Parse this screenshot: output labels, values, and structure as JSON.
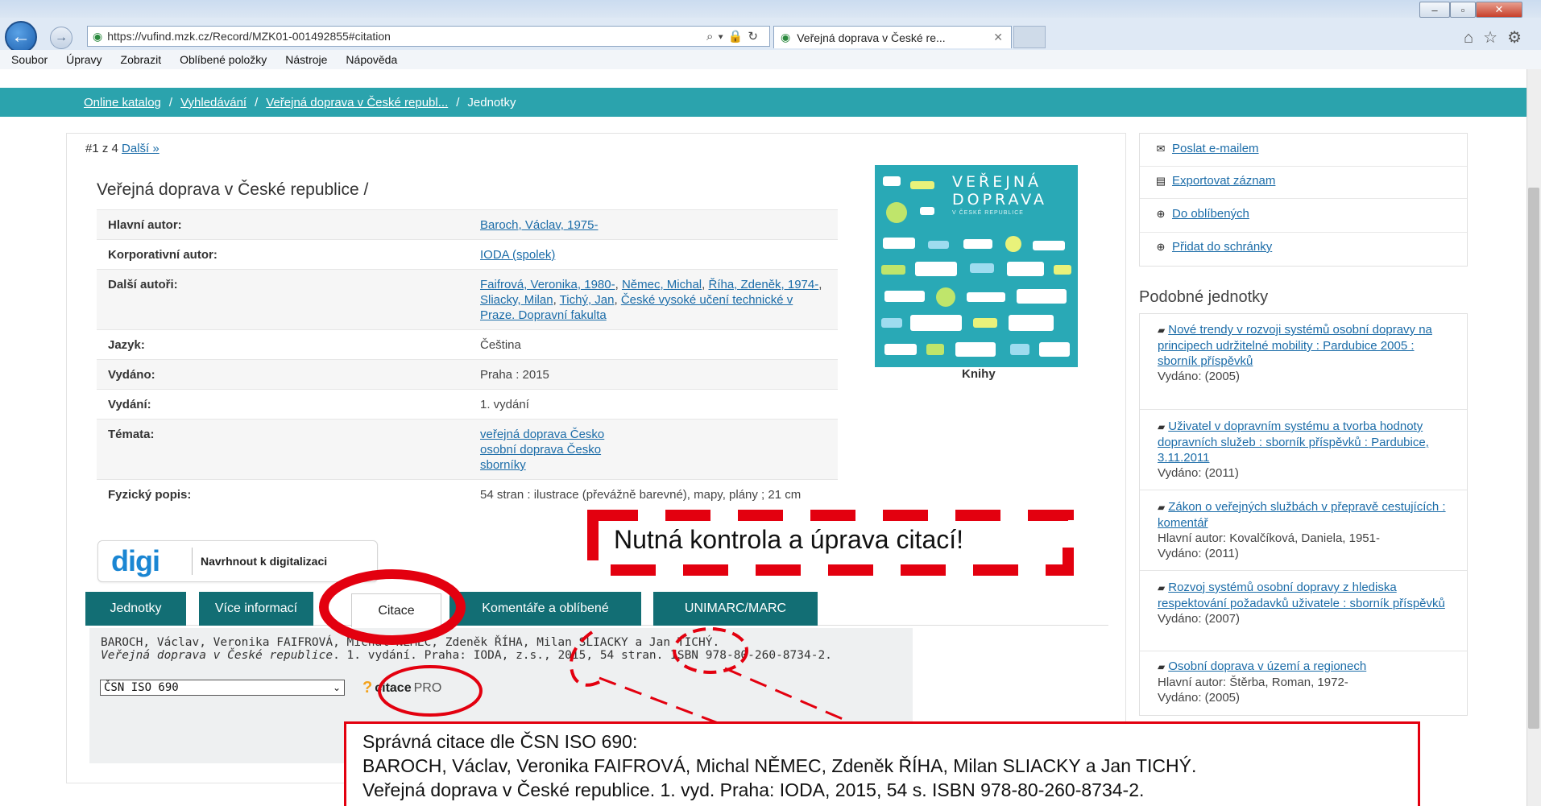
{
  "browser": {
    "url": "https://vufind.mzk.cz/Record/MZK01-001492855#citation",
    "tab_title": "Veřejná doprava v České re...",
    "menu": [
      "Soubor",
      "Úpravy",
      "Zobrazit",
      "Oblíbené položky",
      "Nástroje",
      "Nápověda"
    ]
  },
  "breadcrumb": {
    "items": [
      "Online katalog",
      "Vyhledávání",
      "Veřejná doprava v České republ..."
    ],
    "current": "Jednotky"
  },
  "pager": {
    "position": "#1 z 4",
    "next": "Další »"
  },
  "record": {
    "title": "Veřejná doprava v České republice /",
    "fields": [
      {
        "label": "Hlavní autor:",
        "links": [
          "Baroch, Václav, 1975-"
        ]
      },
      {
        "label": "Korporativní autor:",
        "links": [
          "IODA (spolek)"
        ]
      },
      {
        "label": "Další autoři:",
        "links": [
          "Faifrová, Veronika, 1980-",
          "Němec, Michal",
          "Říha, Zdeněk, 1974-",
          "Sliacky, Milan",
          "Tichý, Jan",
          "České vysoké učení technické v Praze. Dopravní fakulta"
        ]
      },
      {
        "label": "Jazyk:",
        "text": "Čeština"
      },
      {
        "label": "Vydáno:",
        "text": "Praha : 2015"
      },
      {
        "label": "Vydání:",
        "text": "1. vydání"
      },
      {
        "label": "Témata:",
        "links": [
          "veřejná doprava Česko",
          "osobní doprava Česko",
          "sborníky"
        ]
      },
      {
        "label": "Fyzický popis:",
        "text": "54 stran : ilustrace (převážně barevné), mapy, plány ; 21 cm"
      }
    ],
    "cover": {
      "title_lines": [
        "VEŘEJNÁ",
        "DOPRAVA"
      ],
      "subtitle": "V ČESKÉ REPUBLICE",
      "caption": "Knihy"
    }
  },
  "digi": {
    "logo": "digi",
    "label": "Navrhnout k digitalizaci"
  },
  "tabs": [
    "Jednotky",
    "Více informací",
    "Citace",
    "Komentáře a oblíbené",
    "UNIMARC/MARC"
  ],
  "active_tab": "Citace",
  "citation": {
    "text_authors": "BAROCH, Václav, Veronika FAIFROVÁ, Michal NĚMEC, Zdeněk ŘÍHA, Milan SLIACKY a Jan TICHÝ.",
    "text_title": "Veřejná doprava v České republice",
    "text_rest": ". 1. vydání. Praha: IODA, z.s., 2015, 54 stran. ISBN 978-80-260-8734-2.",
    "style_selected": "ČSN ISO 690",
    "citacepro_name": "citace",
    "citacepro_suffix": "PRO"
  },
  "actions": [
    {
      "icon": "envelope-icon",
      "label": "Poslat e-mailem"
    },
    {
      "icon": "export-icon",
      "label": "Exportovat záznam"
    },
    {
      "icon": "plus-circle-icon",
      "label": "Do oblíbených"
    },
    {
      "icon": "plus-circle-icon",
      "label": "Přidat do schránky"
    }
  ],
  "similar": {
    "heading": "Podobné jednotky",
    "items": [
      {
        "title": "Nové trendy v rozvoji systémů osobní dopravy na principech udržitelné mobility : Pardubice 2005 : sborník příspěvků",
        "author": "",
        "published": "Vydáno: (2005)"
      },
      {
        "title": "Uživatel v dopravním systému a tvorba hodnoty dopravních služeb : sborník příspěvků : Pardubice, 3.11.2011",
        "author": "",
        "published": "Vydáno: (2011)"
      },
      {
        "title": "Zákon o veřejných službách v přepravě cestujících : komentář",
        "author": "Hlavní autor: Kovalčíková, Daniela, 1951-",
        "published": "Vydáno: (2011)"
      },
      {
        "title": "Rozvoj systémů osobní dopravy z hlediska respektování požadavků uživatele : sborník příspěvků",
        "author": "",
        "published": "Vydáno: (2007)"
      },
      {
        "title": "Osobní doprava v území a regionech",
        "author": "Hlavní autor: Štěrba, Roman, 1972-",
        "published": "Vydáno: (2005)"
      }
    ]
  },
  "annotations": {
    "warning": "Nutná kontrola a úprava citací!",
    "correct_heading": "Správná citace dle ČSN ISO 690:",
    "correct_line1": "BAROCH, Václav, Veronika FAIFROVÁ, Michal NĚMEC, Zdeněk ŘÍHA, Milan SLIACKY a Jan TICHÝ.",
    "correct_line2": "Veřejná doprava v České republice. 1. vyd. Praha: IODA, 2015, 54 s. ISBN 978-80-260-8734-2.",
    "color": "#e3000f"
  }
}
